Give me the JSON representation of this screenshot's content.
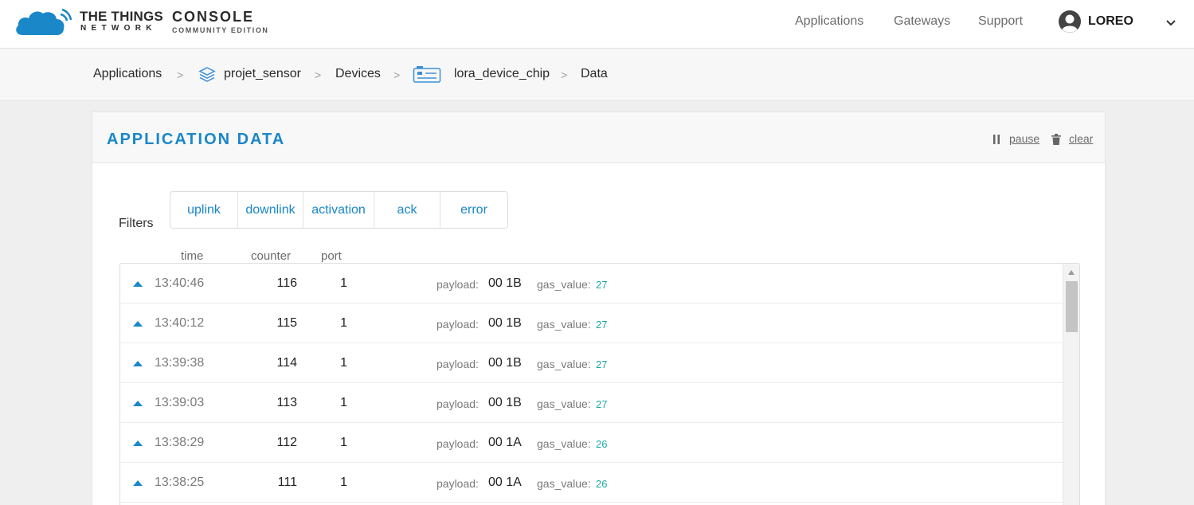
{
  "header": {
    "brand_top": "THE THINGS",
    "brand_bottom": "NETWORK",
    "console_top": "CONSOLE",
    "console_bottom": "COMMUNITY EDITION",
    "nav": [
      "Applications",
      "Gateways",
      "Support"
    ],
    "user": "LOREO",
    "accent": "#1a87c9"
  },
  "breadcrumb": [
    "Applications",
    "projet_sensor",
    "Devices",
    "lora_device_chip",
    "Data"
  ],
  "panel": {
    "title": "APPLICATION DATA",
    "pause_label": "pause",
    "clear_label": "clear",
    "filters_label": "Filters",
    "filters": [
      "uplink",
      "downlink",
      "activation",
      "ack",
      "error"
    ],
    "columns": [
      "time",
      "counter",
      "port"
    ],
    "payload_label": "payload:",
    "gas_label": "gas_value:",
    "rows": [
      {
        "time": "13:40:46",
        "counter": "116",
        "port": "1",
        "payload": "00 1B",
        "gas_value": "27"
      },
      {
        "time": "13:40:12",
        "counter": "115",
        "port": "1",
        "payload": "00 1B",
        "gas_value": "27"
      },
      {
        "time": "13:39:38",
        "counter": "114",
        "port": "1",
        "payload": "00 1B",
        "gas_value": "27"
      },
      {
        "time": "13:39:03",
        "counter": "113",
        "port": "1",
        "payload": "00 1B",
        "gas_value": "27"
      },
      {
        "time": "13:38:29",
        "counter": "112",
        "port": "1",
        "payload": "00 1A",
        "gas_value": "26"
      },
      {
        "time": "13:38:25",
        "counter": "111",
        "port": "1",
        "payload": "00 1A",
        "gas_value": "26"
      }
    ]
  }
}
